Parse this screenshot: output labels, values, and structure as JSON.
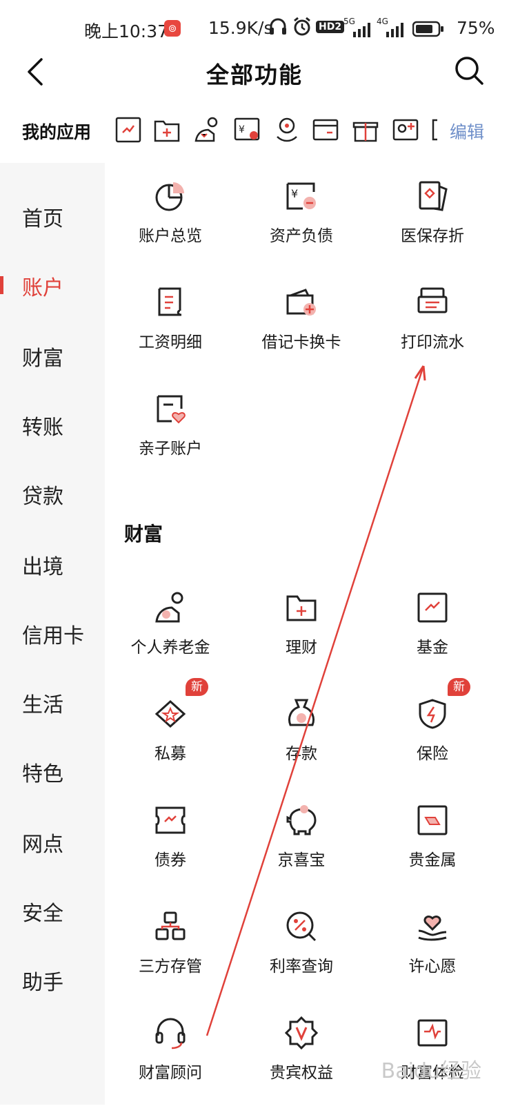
{
  "status": {
    "time": "晚上10:37",
    "speed": "15.9K/s",
    "net1": "HD2",
    "net2": "5G",
    "net3": "4G",
    "battery": "75%"
  },
  "header": {
    "title": "全部功能"
  },
  "my_apps": {
    "label": "我的应用",
    "edit": "编辑",
    "icons": [
      "fund-icon",
      "wealth-folder-icon",
      "pension-icon",
      "debit-exchange-icon",
      "advisor-icon",
      "card-icon",
      "gift-icon",
      "contact-add-icon"
    ]
  },
  "sidebar": {
    "items": [
      "首页",
      "账户",
      "财富",
      "转账",
      "贷款",
      "出境",
      "信用卡",
      "生活",
      "特色",
      "网点",
      "安全",
      "助手"
    ],
    "active": "账户"
  },
  "account": {
    "items": [
      "账户总览",
      "资产负债",
      "医保存折",
      "工资明细",
      "借记卡换卡",
      "打印流水",
      "亲子账户"
    ]
  },
  "wealth": {
    "title": "财富",
    "items": [
      "个人养老金",
      "理财",
      "基金",
      "私募",
      "存款",
      "保险",
      "债券",
      "京喜宝",
      "贵金属",
      "三方存管",
      "利率查询",
      "许心愿",
      "财富顾问",
      "贵宾权益",
      "财富体检"
    ],
    "badge": "新"
  },
  "accent_color": "#e0413a",
  "link_color": "#6f8fc9",
  "watermark": "Baidu经验"
}
